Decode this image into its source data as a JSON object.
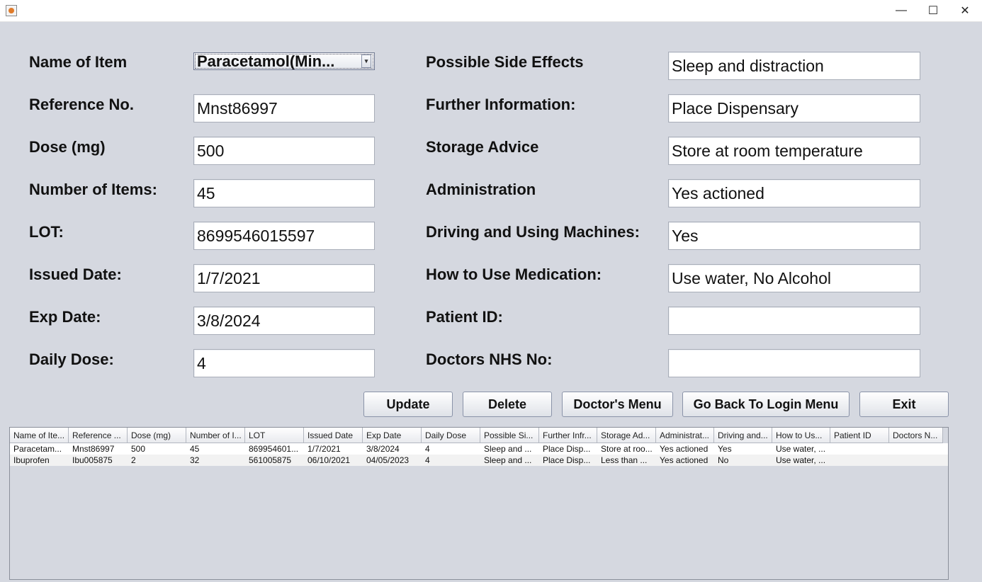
{
  "window": {
    "minimize_glyph": "—",
    "maximize_glyph": "☐",
    "close_glyph": "✕"
  },
  "left_form": {
    "name_of_item": {
      "label": "Name of Item",
      "value": "Paracetamol(Min...",
      "arrow": "▾"
    },
    "reference_no": {
      "label": "Reference No.",
      "value": "Mnst86997"
    },
    "dose": {
      "label": "Dose (mg)",
      "value": "500"
    },
    "number_of_items": {
      "label": "Number of Items:",
      "value": "45"
    },
    "lot": {
      "label": "LOT:",
      "value": "8699546015597"
    },
    "issued_date": {
      "label": "Issued Date:",
      "value": "1/7/2021"
    },
    "exp_date": {
      "label": "Exp Date:",
      "value": "3/8/2024"
    },
    "daily_dose": {
      "label": "Daily Dose:",
      "value": "4"
    }
  },
  "right_form": {
    "side_effects": {
      "label": "Possible Side Effects",
      "value": "Sleep and distraction"
    },
    "further_info": {
      "label": "Further Information:",
      "value": "Place Dispensary"
    },
    "storage_advice": {
      "label": "Storage Advice",
      "value": "Store at room temperature"
    },
    "administration": {
      "label": "Administration",
      "value": "Yes actioned"
    },
    "driving": {
      "label": "Driving and Using Machines:",
      "value": "Yes"
    },
    "how_to_use": {
      "label": "How to Use Medication:",
      "value": "Use water, No Alcohol"
    },
    "patient_id": {
      "label": "Patient ID:",
      "value": ""
    },
    "doctors_nhs": {
      "label": "Doctors NHS No:",
      "value": ""
    }
  },
  "buttons": {
    "update": "Update",
    "delete": "Delete",
    "doctors_menu": "Doctor's Menu",
    "back_to_login": "Go Back To Login Menu",
    "exit": "Exit"
  },
  "table": {
    "headers": [
      "Name of Ite...",
      "Reference ...",
      "Dose (mg)",
      "Number of I...",
      "LOT",
      "Issued Date",
      "Exp Date",
      "Daily Dose",
      "Possible Si...",
      "Further Infr...",
      "Storage Ad...",
      "Administrat...",
      "Driving and...",
      "How to Us...",
      "Patient ID",
      "Doctors N..."
    ],
    "rows": [
      [
        "Paracetam...",
        "Mnst86997",
        "500",
        "45",
        "869954601...",
        "1/7/2021",
        "3/8/2024",
        "4",
        "Sleep and ...",
        "Place Disp...",
        "Store at roo...",
        "Yes actioned",
        "Yes",
        "Use water, ...",
        "",
        ""
      ],
      [
        "Ibuprofen",
        "Ibu005875",
        "2",
        "32",
        "561005875",
        "06/10/2021",
        "04/05/2023",
        "4",
        "Sleep and ...",
        "Place Disp...",
        "Less than ...",
        "Yes actioned",
        "No",
        "Use water, ...",
        "",
        ""
      ]
    ]
  }
}
